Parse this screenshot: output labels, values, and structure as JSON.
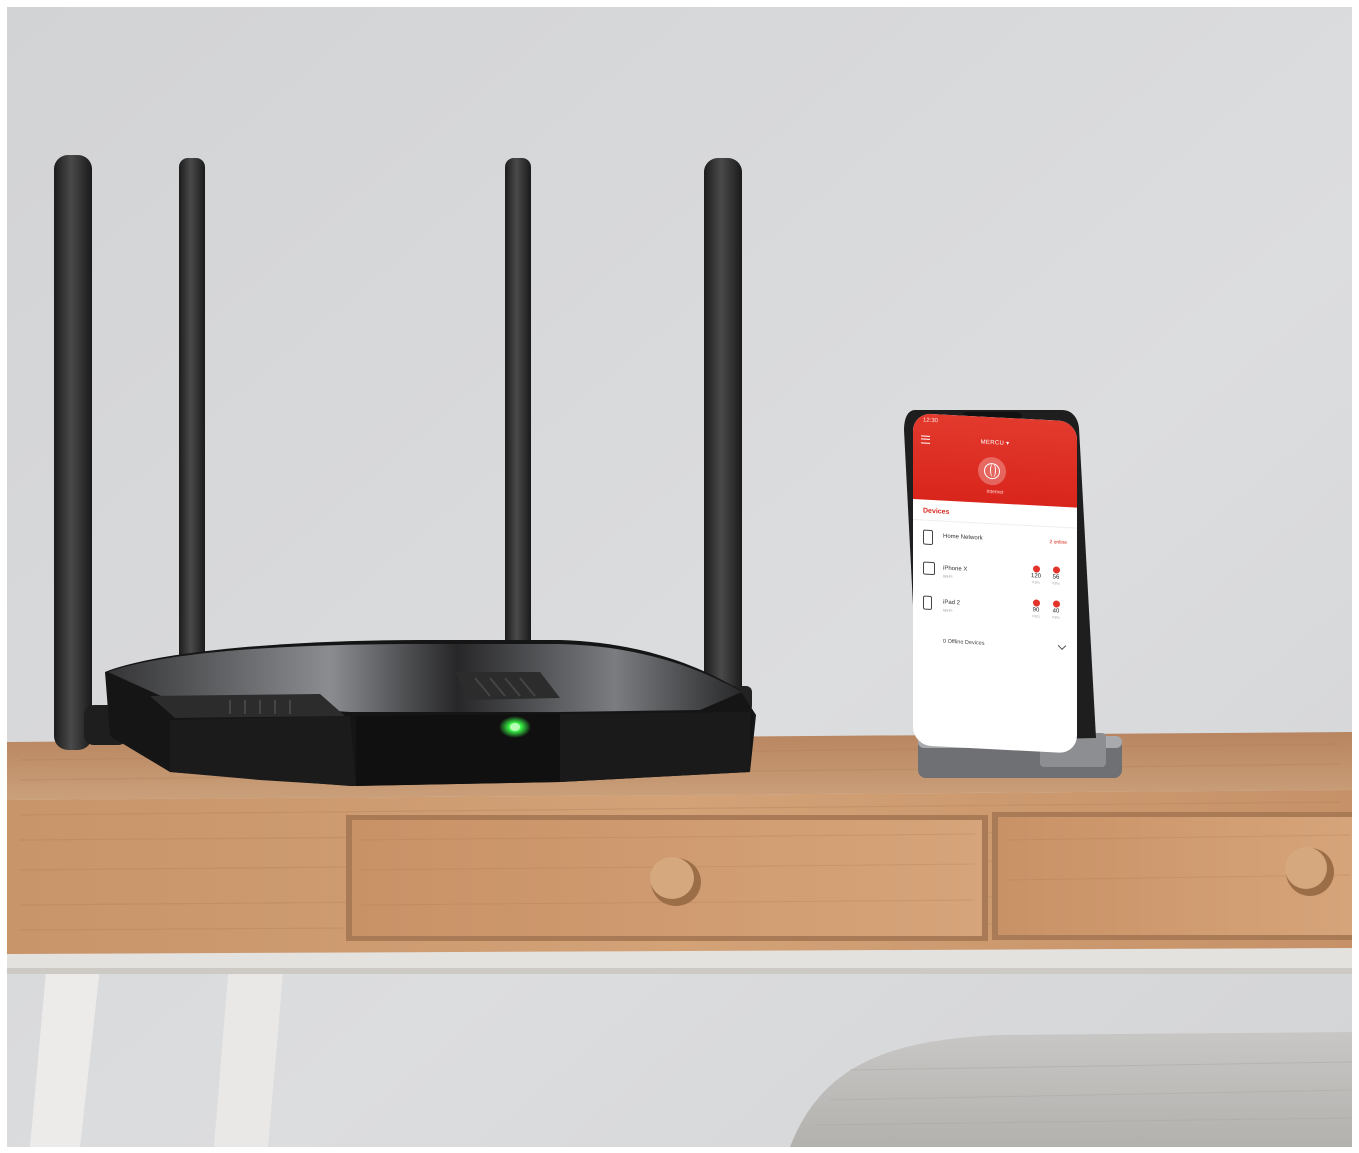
{
  "scene": {
    "description_objects": [
      "router",
      "smartphone",
      "wooden-desk",
      "armchair"
    ],
    "colors": {
      "wall": "#d7d8da",
      "desk_wood": "#c4946a",
      "router_body": "#161616",
      "app_accent": "#d9251c",
      "router_led": "#3cff4a"
    }
  },
  "phone_app": {
    "status_time": "12:30",
    "title": "MERCU ▾",
    "internet_label": "Internet",
    "section": "Devices",
    "home_network": {
      "label": "Home Network",
      "link": "2 online"
    },
    "devices": [
      {
        "name": "iPhone X",
        "sub": "Wi-Fi",
        "down": "120",
        "up": "56",
        "down_unit": "KB/s",
        "up_unit": "KB/s"
      },
      {
        "name": "iPad 2",
        "sub": "Wi-Fi",
        "down": "90",
        "up": "40",
        "down_unit": "KB/s",
        "up_unit": "KB/s"
      }
    ],
    "offline_devices": "0 Offline Devices"
  }
}
